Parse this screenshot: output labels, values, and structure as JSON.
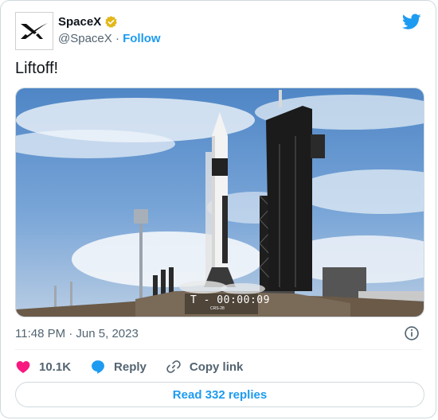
{
  "author": {
    "name": "SpaceX",
    "handle": "@SpaceX",
    "separator": "·",
    "follow_label": "Follow"
  },
  "tweet": {
    "text": "Liftoff!",
    "media": {
      "overlay_text": "T - 00:00:09",
      "overlay_subtext": "CRS-28"
    },
    "time": "11:48 PM · Jun 5, 2023"
  },
  "actions": {
    "likes_count": "10.1K",
    "reply_label": "Reply",
    "copy_link_label": "Copy link"
  },
  "read_replies_label": "Read 332 replies",
  "colors": {
    "accent": "#1d9bf0",
    "like": "#f91880",
    "verified": "#e2b719",
    "text_secondary": "#536471"
  },
  "icons": [
    "spacex-logo-icon",
    "verified-badge-icon",
    "twitter-bird-icon",
    "info-icon",
    "heart-icon",
    "reply-icon",
    "link-icon"
  ]
}
